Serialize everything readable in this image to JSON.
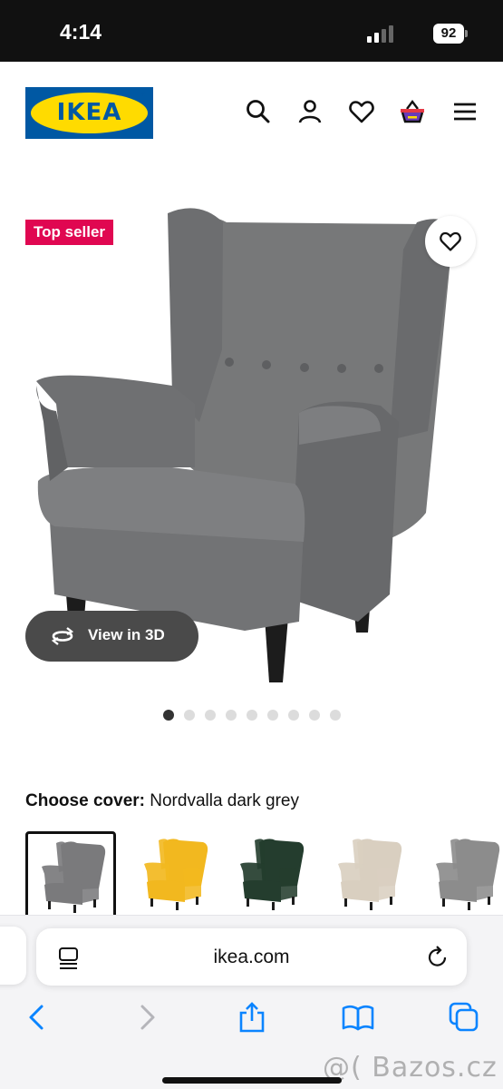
{
  "status_bar": {
    "time": "4:14",
    "battery": "92"
  },
  "header": {
    "logo_text": "IKEA",
    "logo_reg": "®",
    "icons": [
      "search-icon",
      "user-icon",
      "heart-icon",
      "basket-icon",
      "menu-icon"
    ]
  },
  "product": {
    "badge": "Top seller",
    "view_3d_label": "View in 3D",
    "image_count": 9,
    "active_image_index": 0
  },
  "cover": {
    "label": "Choose cover:",
    "selected": "Nordvalla dark grey",
    "options": [
      {
        "color": "#7a7a7c",
        "selected": true
      },
      {
        "color": "#f2b81f",
        "selected": false
      },
      {
        "color": "#243d2e",
        "selected": false
      },
      {
        "color": "#d9cfc0",
        "selected": false
      },
      {
        "color": "#8c8c8c",
        "selected": false
      }
    ]
  },
  "browser": {
    "url": "ikea.com",
    "toolbar": [
      "back-icon",
      "forward-icon",
      "share-icon",
      "bookmarks-icon",
      "tabs-icon"
    ]
  },
  "watermark": "@( Bazos.cz",
  "colors": {
    "brand_blue": "#0058a3",
    "brand_yellow": "#ffdb00",
    "badge": "#e00751",
    "safari_blue": "#0a84ff"
  }
}
